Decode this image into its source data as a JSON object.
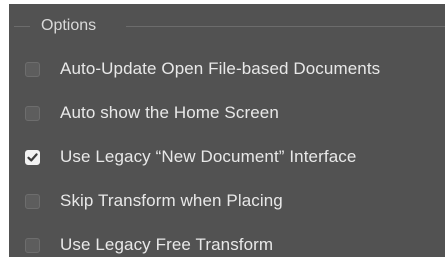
{
  "options_group": {
    "title": "Options",
    "items": [
      {
        "label": "Auto-Update Open File-based Documents",
        "checked": false
      },
      {
        "label": "Auto show the Home Screen",
        "checked": false
      },
      {
        "label": "Use Legacy “New Document” Interface",
        "checked": true
      },
      {
        "label": "Skip Transform when Placing",
        "checked": false
      },
      {
        "label": "Use Legacy Free Transform",
        "checked": false
      }
    ]
  },
  "colors": {
    "panel_background": "#525252",
    "text": "#e8e8e8",
    "checkbox_checked": "#f2f2f2",
    "checkbox_unchecked": "#5d5d5d"
  },
  "icons": {
    "checkmark": "checkmark-icon"
  }
}
